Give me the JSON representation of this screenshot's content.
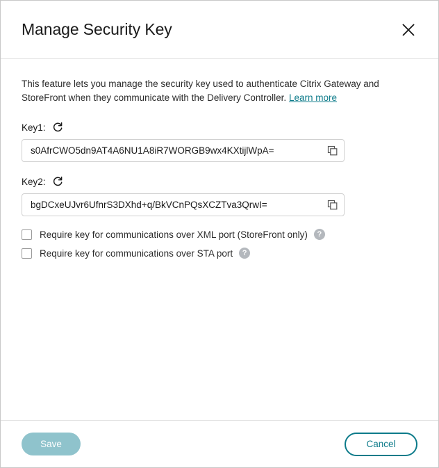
{
  "dialog": {
    "title": "Manage Security Key",
    "close_icon": "close-icon"
  },
  "description": {
    "text": "This feature lets you manage the security key used to authenticate Citrix Gateway and StoreFront when they communicate with the Delivery Controller.",
    "link_label": "Learn more"
  },
  "keys": [
    {
      "label": "Key1:",
      "value": "s0AfrCWO5dn9AT4A6NU1A8iR7WORGB9wx4KXtijlWpA=",
      "refresh_icon": "refresh-icon",
      "copy_icon": "copy-icon"
    },
    {
      "label": "Key2:",
      "value": "bgDCxeUJvr6UfnrS3DXhd+q/BkVCnPQsXCZTva3QrwI=",
      "refresh_icon": "refresh-icon",
      "copy_icon": "copy-icon"
    }
  ],
  "options": [
    {
      "label": "Require key for communications over XML port (StoreFront only)",
      "checked": false,
      "help_icon": "help-icon",
      "help_glyph": "?"
    },
    {
      "label": "Require key for communications over STA port",
      "checked": false,
      "help_icon": "help-icon",
      "help_glyph": "?"
    }
  ],
  "footer": {
    "save_label": "Save",
    "cancel_label": "Cancel"
  },
  "colors": {
    "accent_teal": "#0d7b8a",
    "save_disabled": "#8fc3cc",
    "help_gray": "#b4b8bd",
    "border_gray": "#d0d0d0"
  }
}
